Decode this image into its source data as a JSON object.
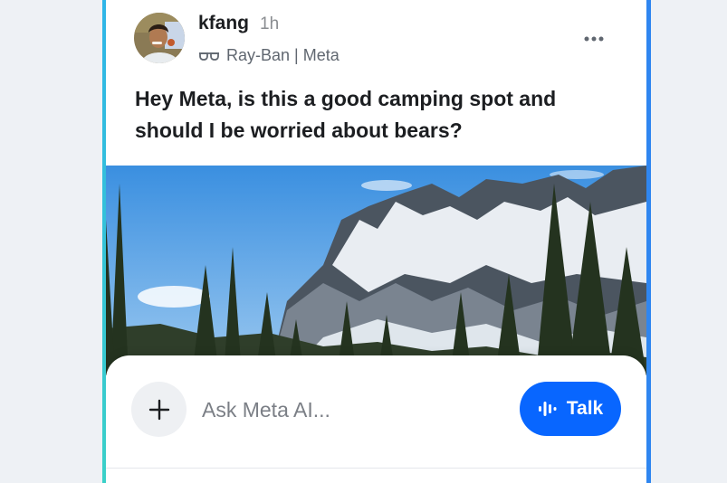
{
  "post": {
    "username": "kfang",
    "time": "1h",
    "device": "Ray-Ban | Meta",
    "question": "Hey Meta, is this a good camping spot and should I be worried about bears?"
  },
  "composer": {
    "placeholder": "Ask Meta AI...",
    "talk_label": "Talk"
  },
  "icons": {
    "device": "glasses-icon",
    "menu": "more-horizontal-icon",
    "add": "plus-icon",
    "voice": "waveform-icon"
  },
  "colors": {
    "accent": "#0866ff",
    "frame_left": "#2fb5e8",
    "frame_right": "#2f86f0"
  }
}
